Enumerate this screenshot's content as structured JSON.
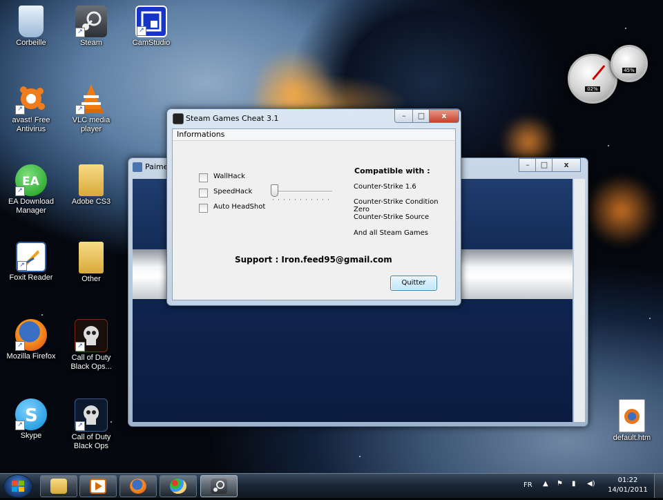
{
  "desktop": {
    "icons": [
      {
        "label": "Corbeille",
        "icon": "recycle-bin-icon"
      },
      {
        "label": "Steam",
        "icon": "steam-icon"
      },
      {
        "label": "CamStudio",
        "icon": "camstudio-icon"
      },
      {
        "label": "avast! Free Antivirus",
        "icon": "avast-icon"
      },
      {
        "label": "VLC media player",
        "icon": "vlc-icon"
      },
      {
        "label": "EA Download Manager",
        "icon": "ea-icon"
      },
      {
        "label": "Adobe CS3",
        "icon": "folder-icon"
      },
      {
        "label": "Foxit Reader",
        "icon": "foxit-icon"
      },
      {
        "label": "Other",
        "icon": "folder-icon"
      },
      {
        "label": "Mozilla Firefox",
        "icon": "firefox-icon"
      },
      {
        "label": "Call of Duty Black Ops...",
        "icon": "blackops-icon"
      },
      {
        "label": "Skype",
        "icon": "skype-icon"
      },
      {
        "label": "Call of Duty Black Ops",
        "icon": "blackops-icon"
      },
      {
        "label": "default.htm",
        "icon": "html-file-icon"
      }
    ]
  },
  "gadget": {
    "cpu_percent": "02%",
    "ram_percent": "45%"
  },
  "background_window": {
    "title": "Paime"
  },
  "cheat_window": {
    "title": "Steam Games Cheat 3.1",
    "menu": "Informations",
    "options": [
      {
        "label": "WallHack",
        "checked": false
      },
      {
        "label": "SpeedHack",
        "checked": false
      },
      {
        "label": "Auto HeadShot",
        "checked": false
      }
    ],
    "speed_slider_value": 0,
    "compatible_title": "Compatible with :",
    "compatible_games": [
      "Counter-Strike 1.6",
      "Counter-Strike Condition Zero",
      "Counter-Strike Source",
      "And all Steam Games"
    ],
    "support": "Support : Iron.feed95@gmail.com",
    "quit_button": "Quitter",
    "caption": {
      "minimize": "–",
      "maximize": "□",
      "close": "x"
    }
  },
  "taskbar": {
    "pinned": [
      "explorer-icon",
      "media-player-icon",
      "firefox-icon",
      "paint-icon",
      "steam-icon"
    ],
    "language": "FR",
    "time": "01:22",
    "date": "14/01/2011"
  }
}
